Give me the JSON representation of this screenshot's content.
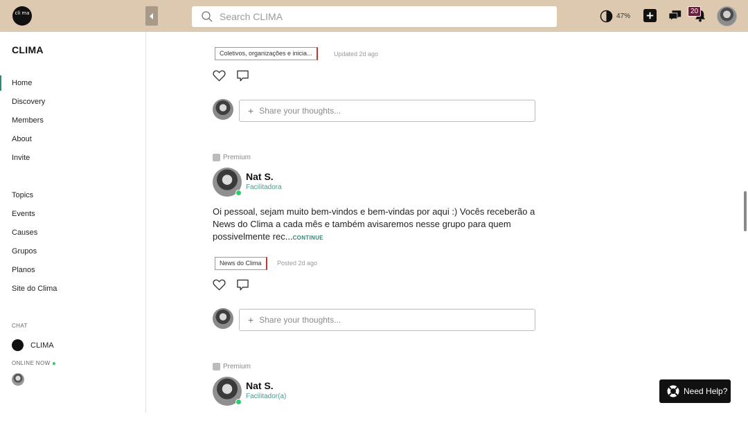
{
  "topbar": {
    "logo_text": "cli ma",
    "search_placeholder": "Search CLIMA",
    "contrast_pct": "47%",
    "notifications_count": "20"
  },
  "sidebar": {
    "brand": "CLIMA",
    "nav": [
      "Home",
      "Discovery",
      "Members",
      "About",
      "Invite"
    ],
    "sections": [
      "Topics",
      "Events",
      "Causes",
      "Grupos",
      "Planos",
      "Site do Clima"
    ],
    "chat_label": "CHAT",
    "chat_item": "CLIMA",
    "online_label": "ONLINE NOW"
  },
  "feed": {
    "post1": {
      "tag": "Coletivos, organizações e inicia...",
      "meta": "Updated 2d ago",
      "comment_placeholder": "Share your thoughts..."
    },
    "post2": {
      "premium": "Premium",
      "author": "Nat S.",
      "role": "Facilitadora",
      "text": "Oi pessoal, sejam muito bem-vindos e bem-vindas por aqui :) Vocês receberão a News do Clima a cada mês e também avisaremos nesse grupo para quem possivelmente rec...",
      "continue": "CONTINUE",
      "tag": "News do Clima",
      "meta": "Posted 2d ago",
      "comment_placeholder": "Share your thoughts..."
    },
    "post3": {
      "premium": "Premium",
      "author": "Nat S.",
      "role": "Facilitador(a)"
    }
  },
  "help": {
    "label": "Need Help?"
  }
}
